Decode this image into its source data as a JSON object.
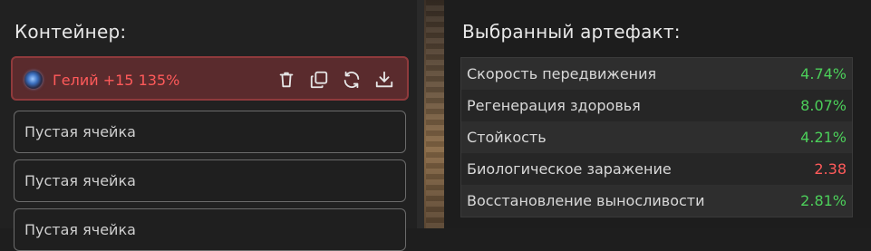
{
  "container": {
    "title": "Контейнер:",
    "artifact": {
      "name": "Гелий +15 135%",
      "icon": "artifact-orb-icon",
      "actions": [
        "trash-icon",
        "copy-icon",
        "refresh-icon",
        "download-icon"
      ]
    },
    "empty_slots": [
      "Пустая ячейка",
      "Пустая ячейка",
      "Пустая ячейка"
    ]
  },
  "selected": {
    "title": "Выбранный артефакт:",
    "stats": [
      {
        "label": "Скорость передвижения",
        "value": "4.74%",
        "status": "positive"
      },
      {
        "label": "Регенерация здоровья",
        "value": "8.07%",
        "status": "positive"
      },
      {
        "label": "Стойкость",
        "value": "4.21%",
        "status": "positive"
      },
      {
        "label": "Биологическое заражение",
        "value": "2.38",
        "status": "negative"
      },
      {
        "label": "Восстановление выносливости",
        "value": "2.81%",
        "status": "positive"
      }
    ]
  },
  "colors": {
    "positive": "#4ccf5a",
    "negative": "#ff5a5a",
    "artifact_border": "#8f3a3c",
    "artifact_bg": "#5a2b2d"
  }
}
